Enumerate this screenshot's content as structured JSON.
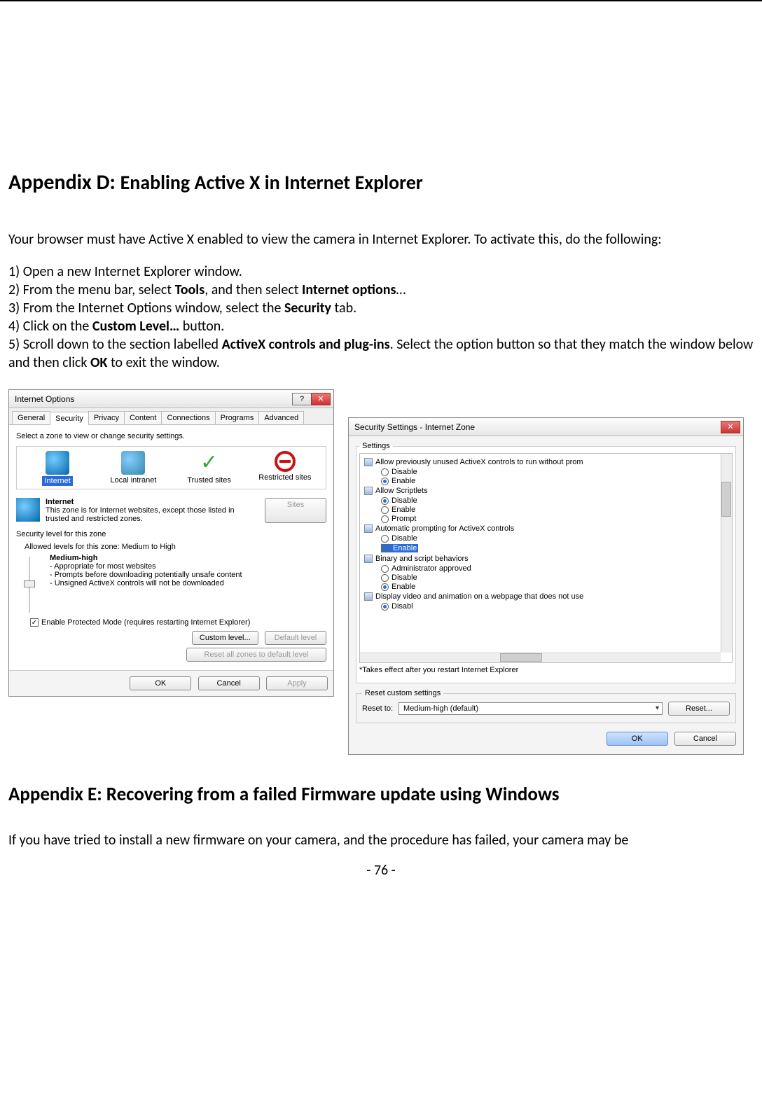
{
  "headings": {
    "appendix_d_prefix": "Appendix D: ",
    "appendix_d_title": "Enabling Active X in Internet Explorer",
    "appendix_e": "Appendix E: Recovering from a failed Firmware update using Windows"
  },
  "intro": "Your browser must have Active X enabled to view the camera in Internet Explorer. To activate this, do the following:",
  "steps": {
    "s1": "1) Open a new Internet Explorer window.",
    "s2a": "2) From the menu bar, select ",
    "s2b": "Tools",
    "s2c": ", and then select ",
    "s2d": "Internet options",
    "s2e": "…",
    "s3a": "3) From the Internet Options window, select the ",
    "s3b": "Security",
    "s3c": " tab.",
    "s4a": "4) Click on the ",
    "s4b": "Custom Level…",
    "s4c": " button.",
    "s5a": "5) Scroll down to the section labelled ",
    "s5b": "ActiveX controls and plug-ins",
    "s5c": ". Select the option button so that they match the window below and then click ",
    "s5d": "OK",
    "s5e": " to exit the window."
  },
  "io": {
    "title": "Internet Options",
    "help_btn": "?",
    "close_btn": "✕",
    "tabs": [
      "General",
      "Security",
      "Privacy",
      "Content",
      "Connections",
      "Programs",
      "Advanced"
    ],
    "zone_prompt": "Select a zone to view or change security settings.",
    "zones": {
      "internet": "Internet",
      "intranet": "Local intranet",
      "trusted": "Trusted sites",
      "restricted": "Restricted sites"
    },
    "zone_heading": "Internet",
    "zone_desc": "This zone is for Internet websites, except those listed in trusted and restricted zones.",
    "sites_btn": "Sites",
    "sec_level_label": "Security level for this zone",
    "allowed_levels": "Allowed levels for this zone: Medium to High",
    "level_name": "Medium-high",
    "level_b1": "- Appropriate for most websites",
    "level_b2": "- Prompts before downloading potentially unsafe content",
    "level_b3": "- Unsigned ActiveX controls will not be downloaded",
    "protected_mode": "Enable Protected Mode (requires restarting Internet Explorer)",
    "custom_level_btn": "Custom level...",
    "default_level_btn": "Default level",
    "reset_all_btn": "Reset all zones to default level",
    "ok": "OK",
    "cancel": "Cancel",
    "apply": "Apply"
  },
  "ss": {
    "title": "Security Settings - Internet Zone",
    "close_btn": "✕",
    "settings_legend": "Settings",
    "nodes": [
      {
        "label": "Allow previously unused ActiveX controls to run without prom",
        "opts": [
          {
            "label": "Disable",
            "sel": false
          },
          {
            "label": "Enable",
            "sel": true
          }
        ]
      },
      {
        "label": "Allow Scriptlets",
        "opts": [
          {
            "label": "Disable",
            "sel": true
          },
          {
            "label": "Enable",
            "sel": false
          },
          {
            "label": "Prompt",
            "sel": false
          }
        ]
      },
      {
        "label": "Automatic prompting for ActiveX controls",
        "opts": [
          {
            "label": "Disable",
            "sel": false
          },
          {
            "label": "Enable",
            "sel": true,
            "hl": true
          }
        ]
      },
      {
        "label": "Binary and script behaviors",
        "opts": [
          {
            "label": "Administrator approved",
            "sel": false
          },
          {
            "label": "Disable",
            "sel": false
          },
          {
            "label": "Enable",
            "sel": true
          }
        ]
      },
      {
        "label": "Display video and animation on a webpage that does not use",
        "opts": [
          {
            "label": "Disable",
            "sel": true,
            "cut": true
          }
        ]
      }
    ],
    "restart_note": "*Takes effect after you restart Internet Explorer",
    "reset_legend": "Reset custom settings",
    "reset_to_label": "Reset to:",
    "reset_combo": "Medium-high (default)",
    "reset_btn": "Reset...",
    "ok": "OK",
    "cancel": "Cancel"
  },
  "outro": "If you have tried to install a new firmware on your camera, and the procedure has failed, your camera may be",
  "page_number": "- 76 -"
}
